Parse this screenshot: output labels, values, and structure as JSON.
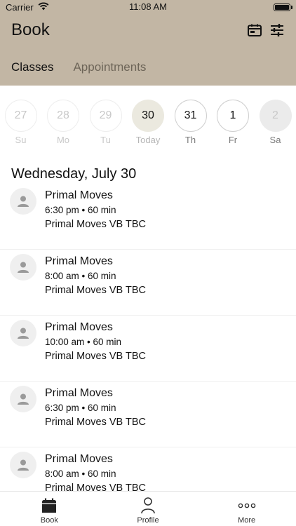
{
  "status_bar": {
    "carrier": "Carrier",
    "time": "11:08 AM",
    "battery_level": 1.0
  },
  "header": {
    "title": "Book",
    "actions": [
      "calendar-icon",
      "filter-sliders-icon"
    ]
  },
  "tabs": [
    {
      "label": "Classes",
      "active": true
    },
    {
      "label": "Appointments",
      "active": false
    }
  ],
  "days": [
    {
      "num": "27",
      "name": "Su",
      "state": "past"
    },
    {
      "num": "28",
      "name": "Mo",
      "state": "past"
    },
    {
      "num": "29",
      "name": "Tu",
      "state": "past"
    },
    {
      "num": "30",
      "name": "Today",
      "state": "today"
    },
    {
      "num": "31",
      "name": "Th",
      "state": "future"
    },
    {
      "num": "1",
      "name": "Fr",
      "state": "future"
    },
    {
      "num": "2",
      "name": "Sa",
      "state": "disabled"
    }
  ],
  "date_heading": "Wednesday, July 30",
  "classes": [
    {
      "name": "Primal Moves",
      "time": "6:30 pm • 60 min",
      "location": "Primal Moves VB TBC"
    },
    {
      "name": "Primal Moves",
      "time": "8:00 am • 60 min",
      "location": "Primal Moves VB TBC"
    },
    {
      "name": "Primal Moves",
      "time": "10:00 am • 60 min",
      "location": "Primal Moves VB TBC"
    },
    {
      "name": "Primal Moves",
      "time": "6:30 pm • 60 min",
      "location": "Primal Moves VB TBC"
    },
    {
      "name": "Primal Moves",
      "time": "8:00 am • 60 min",
      "location": "Primal Moves VB TBC"
    }
  ],
  "tab_bar": [
    {
      "label": "Book",
      "icon": "calendar-icon"
    },
    {
      "label": "Profile",
      "icon": "person-icon"
    },
    {
      "label": "More",
      "icon": "more-dots-icon"
    }
  ],
  "colors": {
    "header_bg": "#c2b6a4",
    "today_bg": "#ebe9df"
  }
}
